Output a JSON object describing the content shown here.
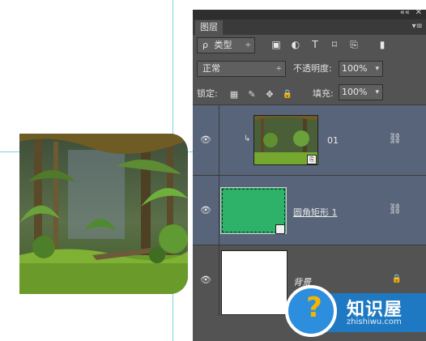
{
  "panel": {
    "tab_title": "图层",
    "collapse_glyph": "««",
    "close_glyph": "✕",
    "menu_glyph": "▾≡",
    "filter": {
      "search_glyph": "ρ",
      "type_label": "类型",
      "arrow": "÷"
    },
    "filter_icons": {
      "image": "▣",
      "adjust": "◐",
      "text": "T",
      "shape": "⌑",
      "smart": "⎘",
      "toggle": "▮"
    },
    "blend_mode": "正常",
    "blend_arrow": "÷",
    "opacity_label": "不透明度:",
    "opacity_value": "100%",
    "lock_label": "锁定:",
    "lock_icons": {
      "pixels": "▦",
      "paint": "✎",
      "move": "✥",
      "all": "🔒"
    },
    "fill_label": "填充:",
    "fill_value": "100%",
    "dropdown_arrow": "▾"
  },
  "layers": [
    {
      "name": "01",
      "eye": "👁",
      "clip_glyph": "↳",
      "link": "⛓"
    },
    {
      "name": "圆角矩形 1",
      "eye": "👁",
      "link": "⛓"
    },
    {
      "name": "背景",
      "eye": "👁",
      "lock": "🔒"
    }
  ],
  "badge": {
    "question_mark": "?",
    "title": "知识屋",
    "subtitle": "zhishiwu.com",
    "colors": {
      "blue": "#1e79c2",
      "yellow": "#f5b400"
    }
  },
  "colors": {
    "panel": "#535353",
    "selected_layer": "#58647a",
    "shape_fill": "#2eb26a",
    "guide": "#7fd3e6"
  }
}
